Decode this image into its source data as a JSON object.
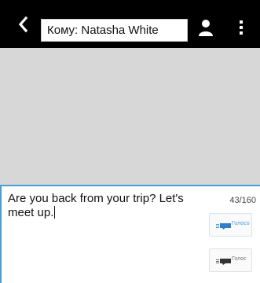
{
  "header": {
    "recipient_label": "Кому: Natasha White",
    "back_icon": "chevron-left-icon",
    "contact_icon": "person-icon",
    "menu_icon": "vertical-dots-icon"
  },
  "composer": {
    "message_text": "Are you back from your trip? Let's meet up.",
    "char_count": "43/160",
    "send_buttons": [
      {
        "label": "Голосо",
        "icon": "send-bubble-icon",
        "state": "active"
      },
      {
        "label": "Голос",
        "icon": "send-bubble-icon",
        "state": "disabled"
      }
    ]
  },
  "colors": {
    "topbar": "#000000",
    "thread_background": "#d7d7d7",
    "accent": "#4a9ed6"
  }
}
